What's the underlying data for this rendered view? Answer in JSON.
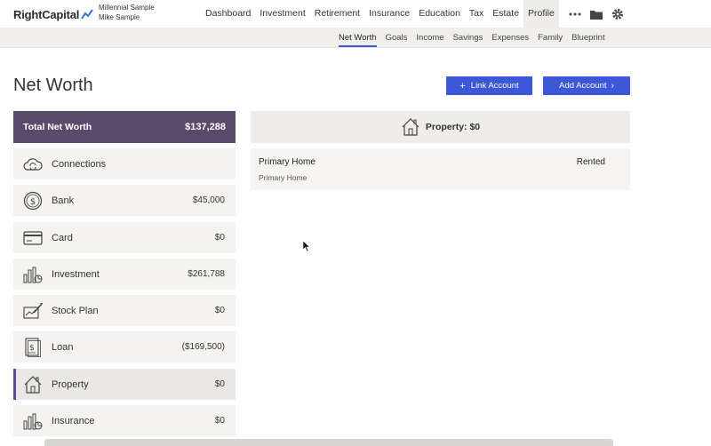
{
  "brand": {
    "name": "RightCapital"
  },
  "client": {
    "line1": "Millennial Sample",
    "line2": "Mike Sample"
  },
  "nav": [
    {
      "label": "Dashboard",
      "active": false
    },
    {
      "label": "Investment",
      "active": false
    },
    {
      "label": "Retirement",
      "active": false
    },
    {
      "label": "Insurance",
      "active": false
    },
    {
      "label": "Education",
      "active": false
    },
    {
      "label": "Tax",
      "active": false
    },
    {
      "label": "Estate",
      "active": false
    },
    {
      "label": "Profile",
      "active": true
    }
  ],
  "nav_icons": [
    "more-icon",
    "folder-icon",
    "gear-icon"
  ],
  "subnav": [
    {
      "label": "Net Worth",
      "active": true
    },
    {
      "label": "Goals",
      "active": false
    },
    {
      "label": "Income",
      "active": false
    },
    {
      "label": "Savings",
      "active": false
    },
    {
      "label": "Expenses",
      "active": false
    },
    {
      "label": "Family",
      "active": false
    },
    {
      "label": "Blueprint",
      "active": false
    }
  ],
  "page": {
    "title": "Net Worth",
    "link_account": "Link Account",
    "add_account": "Add Account"
  },
  "total": {
    "label": "Total Net Worth",
    "value": "$137,288"
  },
  "categories": [
    {
      "label": "Connections",
      "amount": "",
      "icon": "cloud-sync-icon"
    },
    {
      "label": "Bank",
      "amount": "$45,000",
      "icon": "dollar-coin-icon"
    },
    {
      "label": "Card",
      "amount": "$0",
      "icon": "credit-card-icon"
    },
    {
      "label": "Investment",
      "amount": "$261,788",
      "icon": "bar-chart-icon"
    },
    {
      "label": "Stock Plan",
      "amount": "$0",
      "icon": "stock-certificate-icon"
    },
    {
      "label": "Loan",
      "amount": "($169,500)",
      "icon": "loan-document-icon"
    },
    {
      "label": "Property",
      "amount": "$0",
      "icon": "house-icon",
      "active": true
    },
    {
      "label": "Insurance",
      "amount": "$0",
      "icon": "insurance-chart-icon"
    }
  ],
  "panel": {
    "title": "Property: $0",
    "icon": "house-icon",
    "rows": [
      {
        "name": "Primary Home",
        "sub": "Primary Home",
        "status": "Rented"
      }
    ]
  },
  "colors": {
    "accent": "#3d57d9",
    "total_bg": "#5a4a6b",
    "list_bg": "#f4f3ef"
  }
}
